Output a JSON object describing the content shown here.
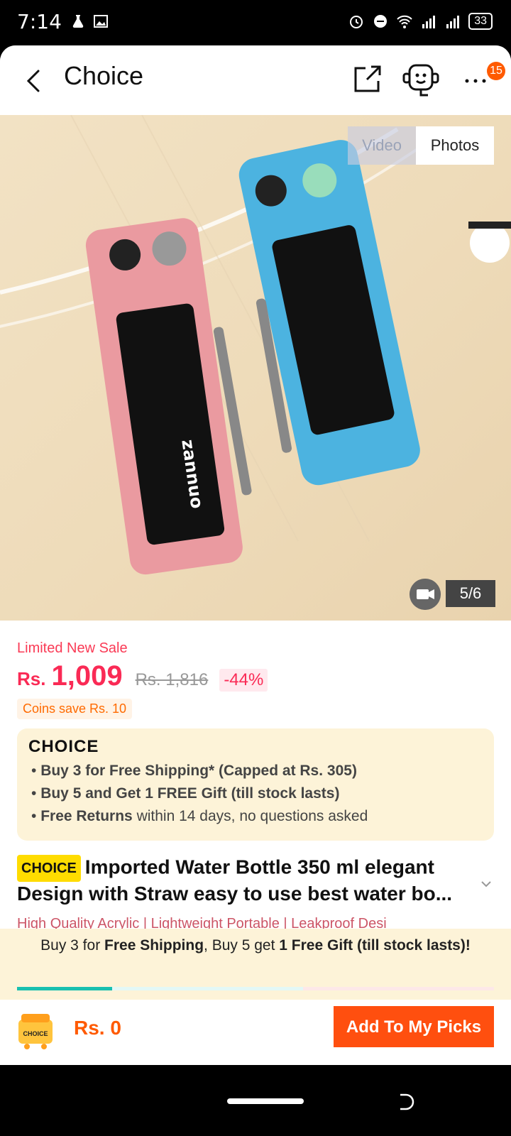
{
  "status_bar": {
    "time": "7:14",
    "battery": "33"
  },
  "header": {
    "title": "Choice",
    "notification_count": "15"
  },
  "gallery": {
    "video_tab": "Video",
    "photos_tab": "Photos",
    "counter": "5/6"
  },
  "sale": {
    "label": "Limited New Sale",
    "currency": "Rs.",
    "price": "1,009",
    "original_price": "Rs. 1,816",
    "discount": "-44%",
    "coins": "Coins save Rs. 10"
  },
  "choice_box": {
    "logo": "CHOICE",
    "line1": "Buy 3 for  Free Shipping* (Capped at Rs. 305)",
    "line2": "Buy 5 and Get 1 FREE Gift (till stock lasts)",
    "line3_bold": "Free Returns",
    "line3_rest": "within 14 days, no questions asked"
  },
  "product": {
    "tag": "CHOICE",
    "title": "Imported Water Bottle 350 ml elegant Design with Straw easy to use best water bo...",
    "highlights": [
      "High Quality Acrylic",
      "Lightweight Portable",
      "Leakproof Desi"
    ]
  },
  "promo": {
    "p1": "Buy 3 for ",
    "p2": "Free Shipping",
    "p3": ", Buy 5 get ",
    "p4": "1 Free Gift (till stock lasts)!",
    "progress_fraction": 0.2
  },
  "bottom_bar": {
    "cart_label": "CHOICE",
    "total": "Rs. 0",
    "add_button": "Add To My Picks"
  },
  "colors": {
    "accent": "#ff4f0f",
    "price": "#fa2a55",
    "choice_bg": "#fdf3d8",
    "progress": "#18c0b0"
  },
  "icons": [
    "back-arrow-icon",
    "share-icon",
    "customer-service-icon",
    "more-icon",
    "video-icon",
    "cart-icon",
    "chevron-down-icon"
  ]
}
